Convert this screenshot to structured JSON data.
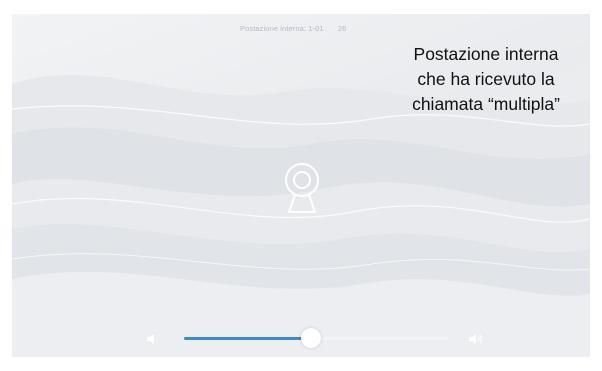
{
  "header": {
    "station": "Postazione interna: 1-01",
    "count": "26"
  },
  "caption": "Postazione interna\nche ha ricevuto la\nchiamata “multipla”",
  "volume": {
    "level": 0.48,
    "accent": "#2e8fd6"
  },
  "icons": {
    "camera": "webcam-icon",
    "volume_down": "speaker-low-icon",
    "volume_up": "speaker-high-icon"
  }
}
